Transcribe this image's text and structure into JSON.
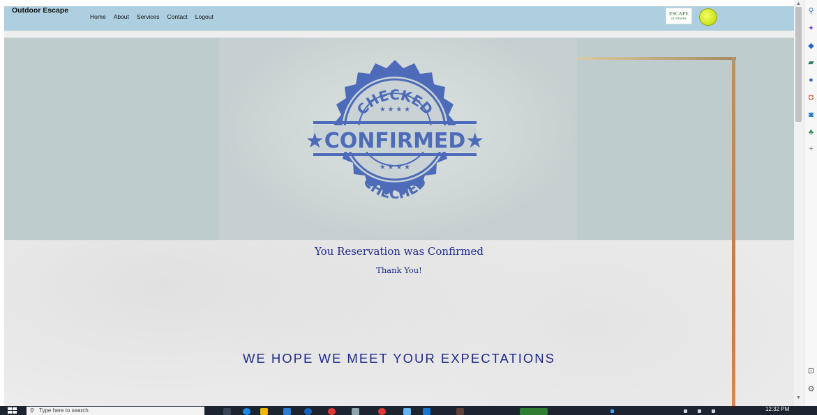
{
  "site": {
    "brand": "Outdoor Escape",
    "nav": [
      "Home",
      "About",
      "Services",
      "Contact",
      "Logout"
    ],
    "logo_text": "ESCAPE",
    "logo_subtext": "OUTDOORS"
  },
  "stamp": {
    "top_text": "CHECKED",
    "center_text": "★CONFIRMED★",
    "bottom_text": "CHECHED",
    "color": "#4d6bb8"
  },
  "message": {
    "title": "You Reservation was Confirmed",
    "subtitle": "Thank You!",
    "tagline": "WE HOPE WE MEET YOUR EXPECTATIONS"
  },
  "colors": {
    "navbar": "#aecfdf",
    "text_accent": "#1f2a8a",
    "hero": "#bfcccd"
  },
  "taskbar": {
    "search_placeholder": "Type here to search",
    "time": "12:32 PM"
  },
  "sidepanel": {
    "icons": [
      "search-icon",
      "copilot-icon",
      "shopping-icon",
      "tools-icon",
      "people-icon",
      "office-icon",
      "outlook-icon",
      "tree-icon",
      "add-icon",
      "panel-icon",
      "settings-icon"
    ]
  }
}
